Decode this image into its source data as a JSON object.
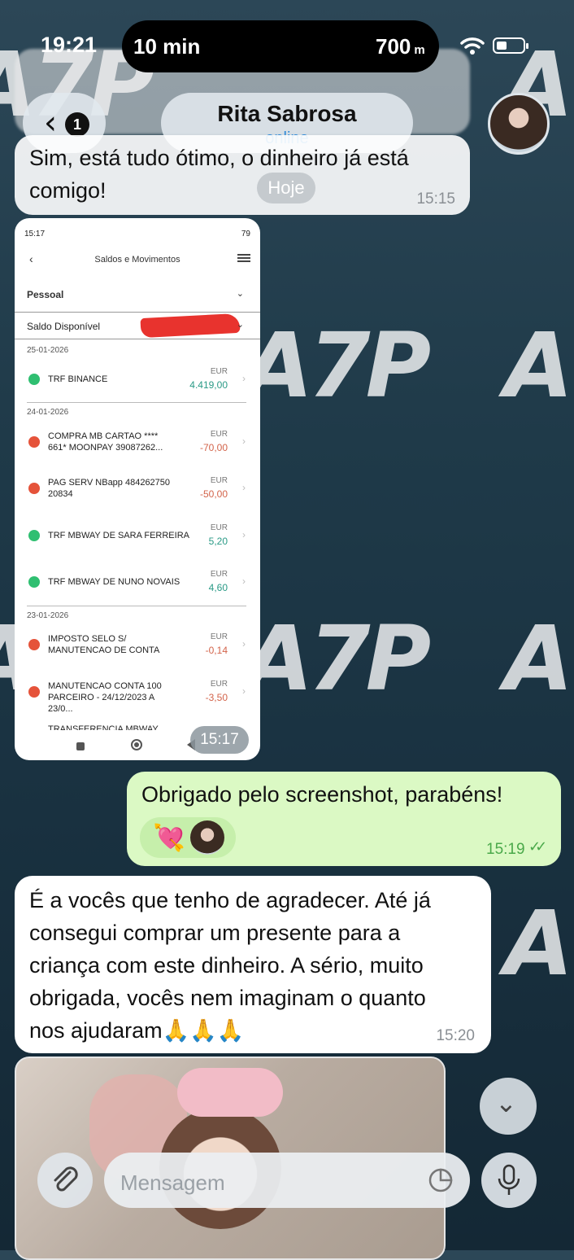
{
  "status_bar": {
    "time": "19:21",
    "island_left": "10 min",
    "island_right": "700",
    "island_unit": "m"
  },
  "header": {
    "back_badge": "1",
    "contact_name": "Rita Sabrosa",
    "contact_status": "online"
  },
  "previous_message": {
    "text": "Sim, está tudo ótimo, o dinheiro já está comigo!",
    "time": "15:15"
  },
  "date_chip": "Hoje",
  "screenshot": {
    "status_time": "15:17",
    "battery": "79",
    "title": "Saldos e Movimentos",
    "account": "Pessoal",
    "balance_label": "Saldo Disponível",
    "groups": [
      {
        "date": "25-01-2026",
        "rows": [
          {
            "desc": "TRF BINANCE",
            "currency": "EUR",
            "amount": "4.419,00",
            "type": "pos"
          }
        ]
      },
      {
        "date": "24-01-2026",
        "rows": [
          {
            "desc": "COMPRA MB CARTAO **** 661* MOONPAY 39087262...",
            "currency": "EUR",
            "amount": "-70,00",
            "type": "neg"
          },
          {
            "desc": "PAG SERV NBapp 484262750 20834",
            "currency": "EUR",
            "amount": "-50,00",
            "type": "neg"
          },
          {
            "desc": "TRF MBWAY DE SARA FERREIRA",
            "currency": "EUR",
            "amount": "5,20",
            "type": "pos"
          },
          {
            "desc": "TRF MBWAY DE NUNO NOVAIS",
            "currency": "EUR",
            "amount": "4,60",
            "type": "pos"
          }
        ]
      },
      {
        "date": "23-01-2026",
        "rows": [
          {
            "desc": "IMPOSTO SELO S/ MANUTENCAO DE CONTA",
            "currency": "EUR",
            "amount": "-0,14",
            "type": "neg"
          },
          {
            "desc": "MANUTENCAO CONTA 100 PARCEIRO - 24/12/2023 A 23/0...",
            "currency": "EUR",
            "amount": "-3,50",
            "type": "neg"
          }
        ]
      }
    ],
    "cutoff_text": "TRANSFERENCIA MBWAY",
    "message_time": "15:17"
  },
  "sent_message": {
    "text": "Obrigado pelo screenshot, parabéns!",
    "time": "15:19",
    "reaction": "💘"
  },
  "reply_message": {
    "lines": [
      "É a vocês que tenho de agradecer. Até já",
      "consegui comprar um presente para a",
      "criança com este dinheiro. A sério, muito",
      "obrigada, vocês nem imaginam o quanto",
      "nos ajudaram"
    ],
    "emoji": "🙏🙏🙏",
    "time": "15:20"
  },
  "watermark": "A7P",
  "composer": {
    "placeholder": "Mensagem"
  },
  "icons": [
    "back-chevron-icon",
    "wifi-icon",
    "battery-icon",
    "paperclip-icon",
    "sticker-icon",
    "microphone-icon",
    "chevron-down-icon",
    "double-check-icon"
  ]
}
